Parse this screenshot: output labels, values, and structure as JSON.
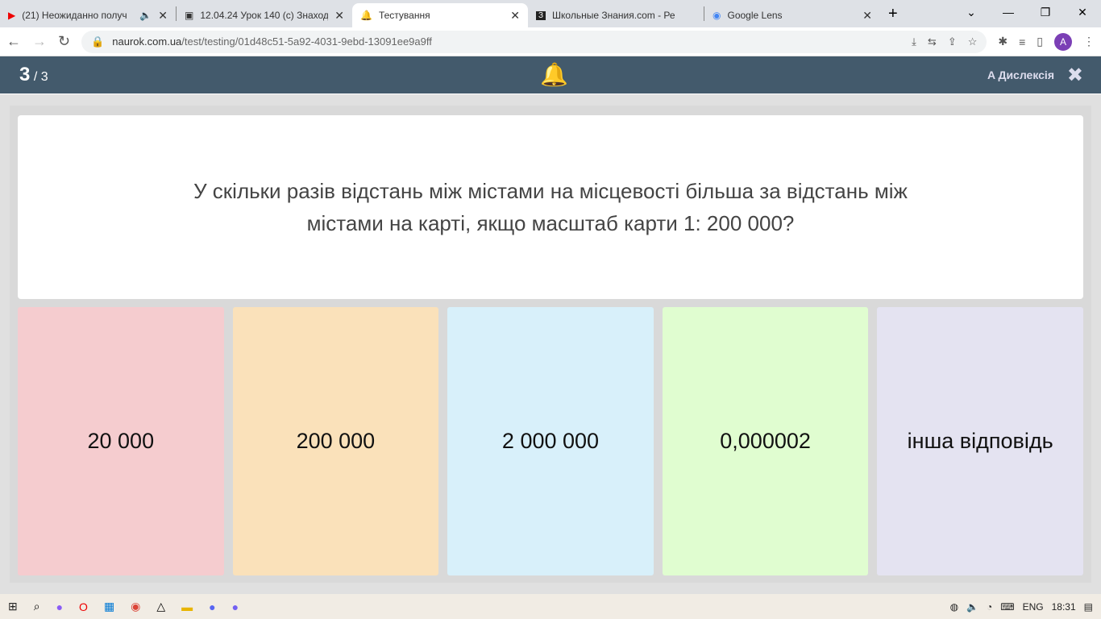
{
  "browser": {
    "tabs": [
      {
        "title": "(21) Неожиданно получ",
        "icon": "youtube-icon",
        "active": false
      },
      {
        "title": "12.04.24 Урок 140 (с) Знаход",
        "icon": "classroom-icon",
        "active": false
      },
      {
        "title": "Тестування",
        "icon": "bell-icon",
        "active": true
      },
      {
        "title": "Школьные Знания.com - Ре",
        "icon": "znanija-icon",
        "active": false
      },
      {
        "title": "Google Lens",
        "icon": "lens-icon",
        "active": false
      }
    ],
    "url_host": "naurok.com.ua",
    "url_path": "/test/testing/01d48c51-5a92-4031-9ebd-13091ee9a9ff",
    "avatar": "A"
  },
  "header": {
    "current": "3",
    "total": "/ 3",
    "dyslexia": "A Дислексія"
  },
  "question": "У скільки разів відстань між містами на місцевості більша за відстань між містами на карті, якщо масштаб карти 1: 200 000?",
  "answers": [
    {
      "label": "20 000",
      "color": "#f5cccf"
    },
    {
      "label": "200 000",
      "color": "#fae1ba"
    },
    {
      "label": "2 000 000",
      "color": "#d8f0fa"
    },
    {
      "label": "0,000002",
      "color": "#e0fdd0"
    },
    {
      "label": "інша відповідь",
      "color": "#e4e3f1"
    }
  ],
  "taskbar": {
    "lang": "ENG",
    "time": "18:31"
  }
}
